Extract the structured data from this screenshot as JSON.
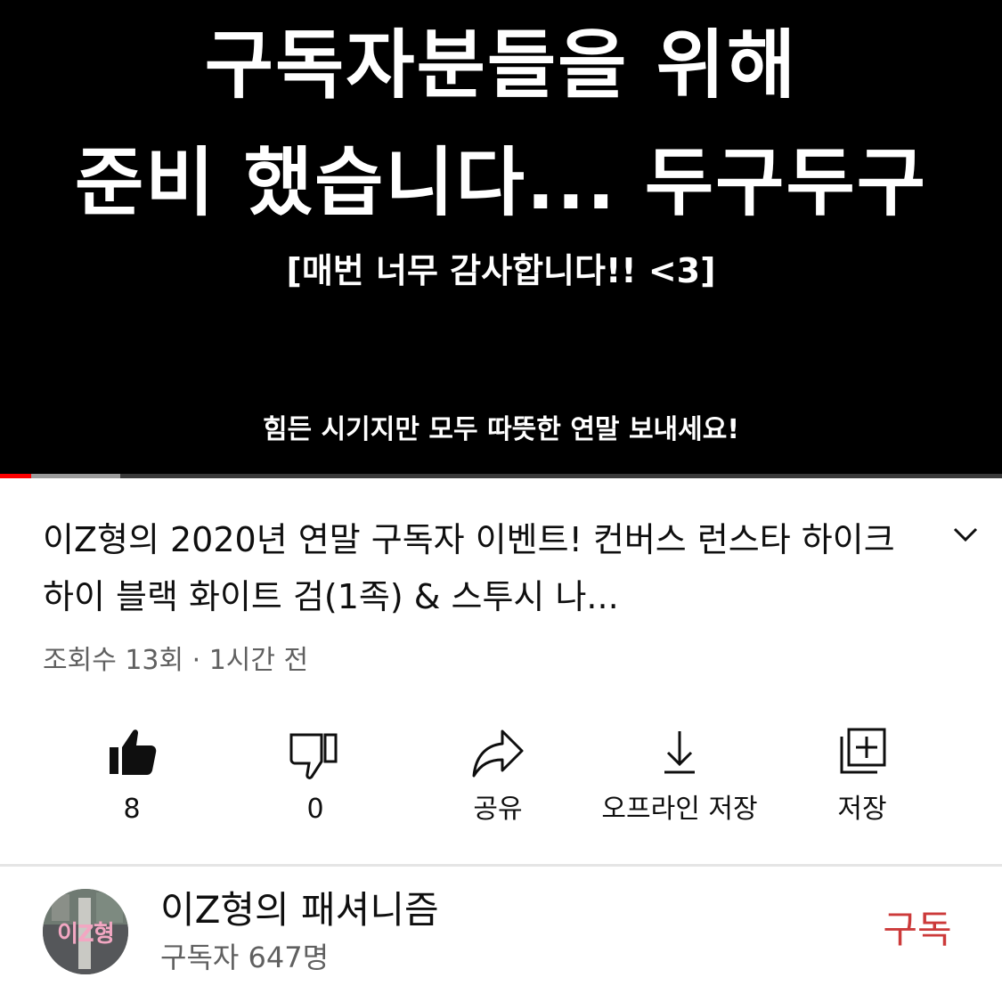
{
  "video": {
    "line1": "구독자분들을 위해",
    "line2": "준비 했습니다... 두구두구",
    "line3": "[매번 너무 감사합니다!! <3]",
    "line4": "힘든 시기지만 모두 따뜻한 연말 보내세요!",
    "progress_played_fraction": 0.031,
    "progress_buffered_fraction": 0.12
  },
  "details": {
    "title": "이Z형의 2020년 연말 구독자 이벤트! 컨버스 런스타 하이크 하이 블랙 화이트 검(1족) & 스투시 나...",
    "meta": "조회수 13회 · 1시간 전",
    "expand_icon": "chevron-down-icon"
  },
  "actions": {
    "like": {
      "icon": "thumbs-up-icon",
      "label": "8"
    },
    "dislike": {
      "icon": "thumbs-down-icon",
      "label": "0"
    },
    "share": {
      "icon": "share-arrow-icon",
      "label": "공유"
    },
    "download": {
      "icon": "download-icon",
      "label": "오프라인 저장"
    },
    "save": {
      "icon": "playlist-add-icon",
      "label": "저장"
    }
  },
  "channel": {
    "avatar_text": "이Z형",
    "name": "이Z형의 패셔니즘",
    "subscribers": "구독자 647명",
    "subscribe_label": "구독",
    "subscribe_color": "#cc3a3a"
  }
}
